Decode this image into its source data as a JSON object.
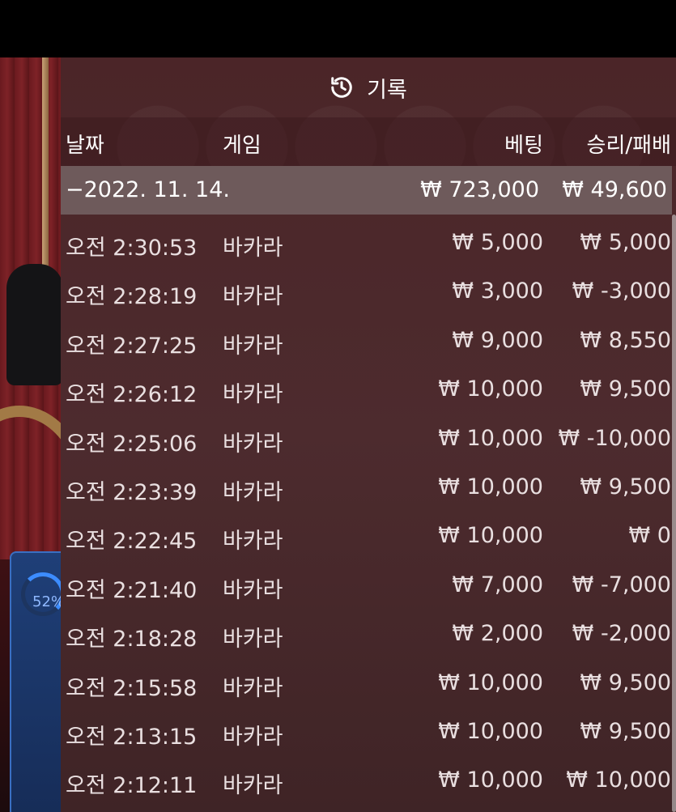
{
  "panel": {
    "title": "기록",
    "icon": "history-icon"
  },
  "columns": {
    "date": "날짜",
    "game": "게임",
    "bet": "베팅",
    "win_loss": "승리/패배"
  },
  "summary": {
    "date": "−2022. 11. 14.",
    "bet": "₩ 723,000",
    "win_loss": "₩ 49,600"
  },
  "rows": [
    {
      "time": "오전 2:30:53",
      "game": "바카라",
      "bet": "₩ 5,000",
      "win_loss": "₩ 5,000"
    },
    {
      "time": "오전 2:28:19",
      "game": "바카라",
      "bet": "₩ 3,000",
      "win_loss": "₩ -3,000"
    },
    {
      "time": "오전 2:27:25",
      "game": "바카라",
      "bet": "₩ 9,000",
      "win_loss": "₩ 8,550"
    },
    {
      "time": "오전 2:26:12",
      "game": "바카라",
      "bet": "₩ 10,000",
      "win_loss": "₩ 9,500"
    },
    {
      "time": "오전 2:25:06",
      "game": "바카라",
      "bet": "₩ 10,000",
      "win_loss": "₩ -10,000"
    },
    {
      "time": "오전 2:23:39",
      "game": "바카라",
      "bet": "₩ 10,000",
      "win_loss": "₩ 9,500"
    },
    {
      "time": "오전 2:22:45",
      "game": "바카라",
      "bet": "₩ 10,000",
      "win_loss": "₩ 0"
    },
    {
      "time": "오전 2:21:40",
      "game": "바카라",
      "bet": "₩ 7,000",
      "win_loss": "₩ -7,000"
    },
    {
      "time": "오전 2:18:28",
      "game": "바카라",
      "bet": "₩ 2,000",
      "win_loss": "₩ -2,000"
    },
    {
      "time": "오전 2:15:58",
      "game": "바카라",
      "bet": "₩ 10,000",
      "win_loss": "₩ 9,500"
    },
    {
      "time": "오전 2:13:15",
      "game": "바카라",
      "bet": "₩ 10,000",
      "win_loss": "₩ 9,500"
    },
    {
      "time": "오전 2:12:11",
      "game": "바카라",
      "bet": "₩ 10,000",
      "win_loss": "₩ 10,000"
    }
  ],
  "background": {
    "progress_label": "52%",
    "progress_value": 0.52
  },
  "colors": {
    "panel_bg": "#4d2a2d",
    "summary_bg": "#6e5a5b",
    "text": "#ffffff",
    "progress_accent": "#3c8cff"
  }
}
